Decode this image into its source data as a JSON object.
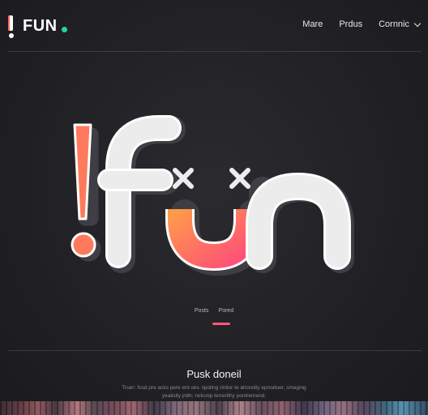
{
  "brand": {
    "name": "FUN",
    "accent_color": "#27d3a0"
  },
  "nav": {
    "items": [
      {
        "label": "Mare"
      },
      {
        "label": "Prdus"
      },
      {
        "label": "Cornnic",
        "has_dropdown": true
      }
    ]
  },
  "hero": {
    "logo_text": "!fun",
    "colors": {
      "exclamation": "#ff7a5c",
      "letters": "#ededed",
      "smile_start": "#ff9a4a",
      "smile_end": "#ff4f78",
      "shadow": "#3e3e44"
    }
  },
  "tabs": {
    "items": [
      {
        "label": "Posts"
      },
      {
        "label": "Pored"
      }
    ],
    "indicator_color": "#ff5a7a"
  },
  "section": {
    "title": "Pusk doneil",
    "body": "Truer: fosd pre acks pere ent oes -tpoting rinitor te ahcreitiy epnoduer, smeging yealisity jnith; nolicnip terrerithy pontremend."
  }
}
